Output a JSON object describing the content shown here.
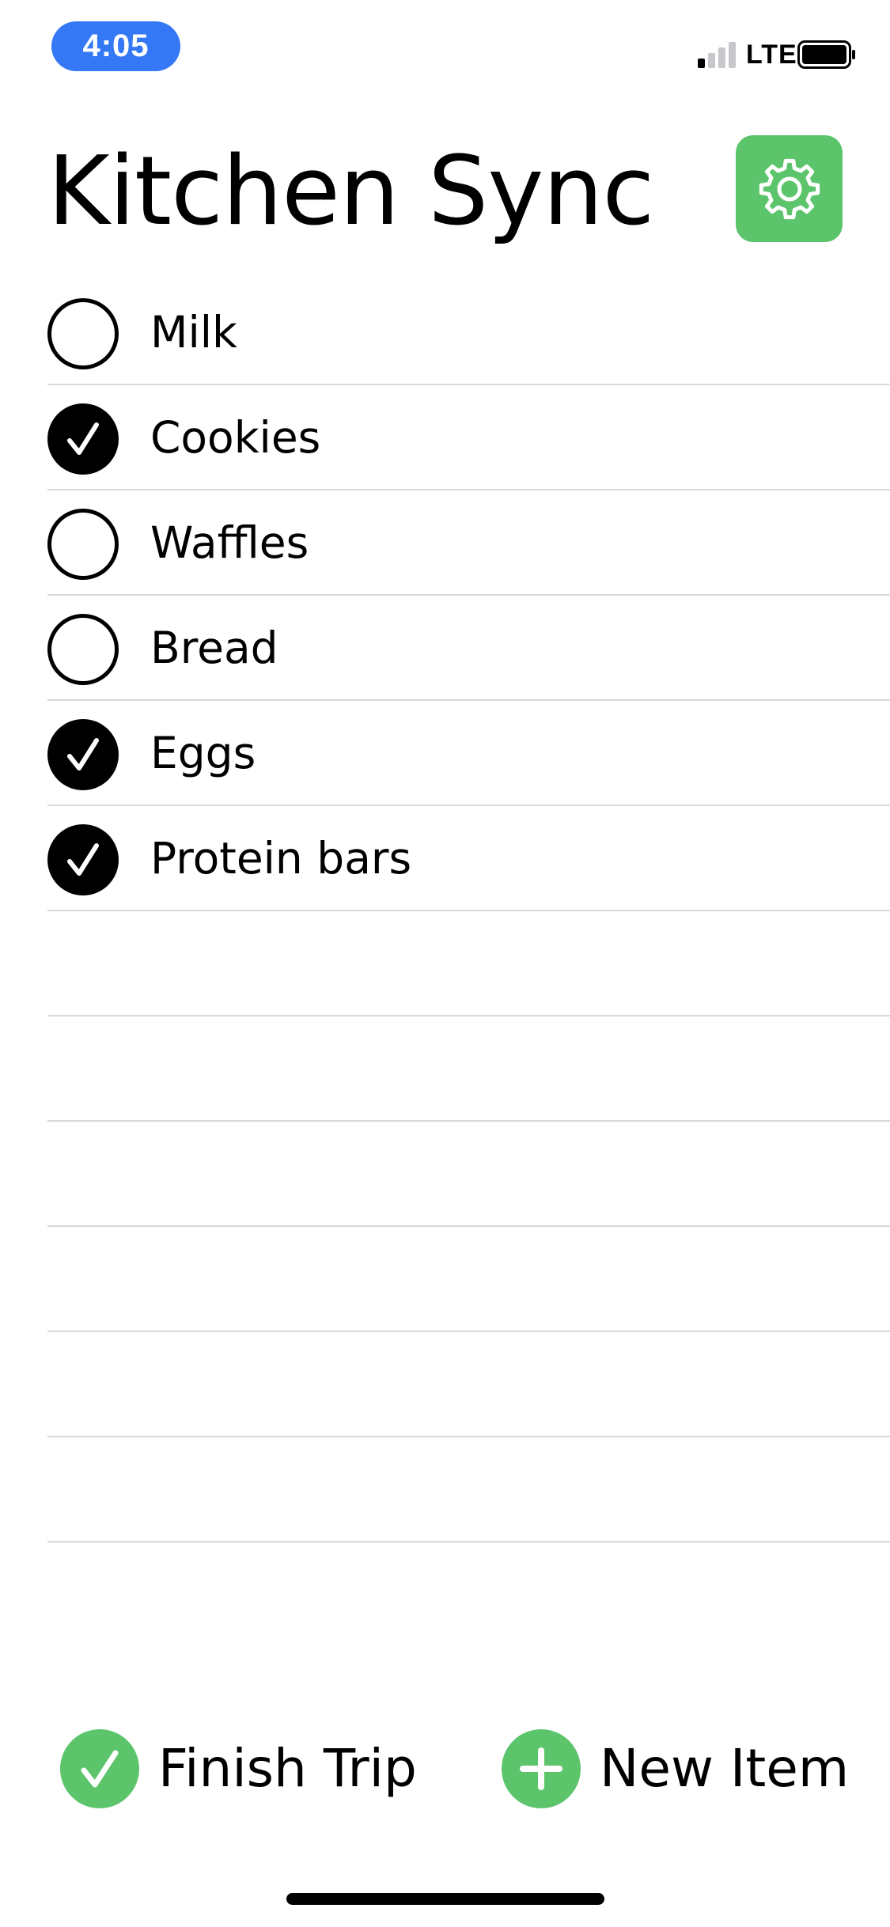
{
  "status_bar": {
    "time": "4:05",
    "network": "LTE",
    "signal_bars_active": 1,
    "signal_bars_total": 4,
    "battery_level": 1.0,
    "time_pill_color": "#3478F6"
  },
  "header": {
    "title": "Kitchen Sync",
    "settings_icon": "gear-icon"
  },
  "list": {
    "items": [
      {
        "label": "Milk",
        "checked": false
      },
      {
        "label": "Cookies",
        "checked": true
      },
      {
        "label": "Waffles",
        "checked": false
      },
      {
        "label": "Bread",
        "checked": false
      },
      {
        "label": "Eggs",
        "checked": true
      },
      {
        "label": "Protein bars",
        "checked": true
      }
    ],
    "empty_rows": 6
  },
  "actions": {
    "finish_trip_label": "Finish Trip",
    "finish_trip_icon": "checkmark-icon",
    "new_item_label": "New Item",
    "new_item_icon": "plus-icon"
  },
  "colors": {
    "accent": "#5CC46A",
    "divider": "#d9d9d9",
    "text": "#000000"
  }
}
